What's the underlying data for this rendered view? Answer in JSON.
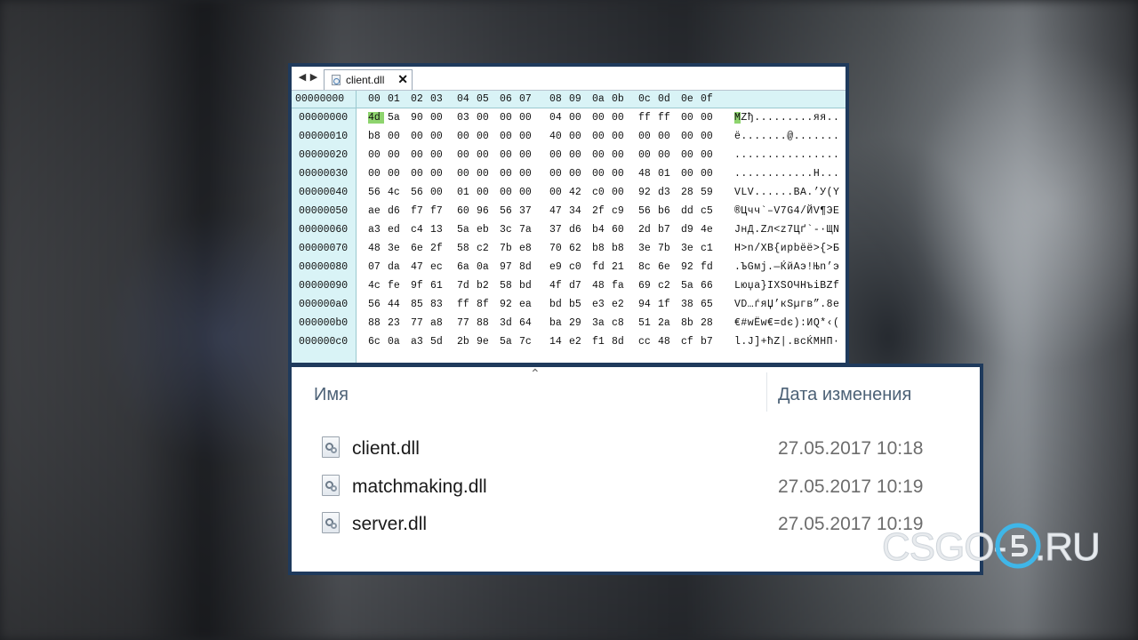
{
  "hex_editor": {
    "tab": {
      "title": "client.dll",
      "close": "✕"
    },
    "nav": {
      "back": "◀",
      "forward": "▶"
    },
    "header": {
      "offset": "00000000",
      "columns": [
        "00",
        "01",
        "02",
        "03",
        "04",
        "05",
        "06",
        "07",
        "08",
        "09",
        "0a",
        "0b",
        "0c",
        "0d",
        "0e",
        "0f"
      ]
    },
    "rows": [
      {
        "offset": "00000000",
        "bytes": [
          "4d",
          "5a",
          "90",
          "00",
          "03",
          "00",
          "00",
          "00",
          "04",
          "00",
          "00",
          "00",
          "ff",
          "ff",
          "00",
          "00"
        ],
        "ascii": "MZђ.........яя.."
      },
      {
        "offset": "00000010",
        "bytes": [
          "b8",
          "00",
          "00",
          "00",
          "00",
          "00",
          "00",
          "00",
          "40",
          "00",
          "00",
          "00",
          "00",
          "00",
          "00",
          "00"
        ],
        "ascii": "ё.......@......."
      },
      {
        "offset": "00000020",
        "bytes": [
          "00",
          "00",
          "00",
          "00",
          "00",
          "00",
          "00",
          "00",
          "00",
          "00",
          "00",
          "00",
          "00",
          "00",
          "00",
          "00"
        ],
        "ascii": "................"
      },
      {
        "offset": "00000030",
        "bytes": [
          "00",
          "00",
          "00",
          "00",
          "00",
          "00",
          "00",
          "00",
          "00",
          "00",
          "00",
          "00",
          "48",
          "01",
          "00",
          "00"
        ],
        "ascii": "............H..."
      },
      {
        "offset": "00000040",
        "bytes": [
          "56",
          "4c",
          "56",
          "00",
          "01",
          "00",
          "00",
          "00",
          "00",
          "42",
          "c0",
          "00",
          "92",
          "d3",
          "28",
          "59"
        ],
        "ascii": "VLV......BA.’У(Y"
      },
      {
        "offset": "00000050",
        "bytes": [
          "ae",
          "d6",
          "f7",
          "f7",
          "60",
          "96",
          "56",
          "37",
          "47",
          "34",
          "2f",
          "c9",
          "56",
          "b6",
          "dd",
          "c5"
        ],
        "ascii": "®Цчч`–V7G4/ЙV¶ЭЕ"
      },
      {
        "offset": "00000060",
        "bytes": [
          "a3",
          "ed",
          "c4",
          "13",
          "5a",
          "eb",
          "3c",
          "7a",
          "37",
          "d6",
          "b4",
          "60",
          "2d",
          "b7",
          "d9",
          "4e"
        ],
        "ascii": "JнД.Zл<z7Цґ`-·ЩN"
      },
      {
        "offset": "00000070",
        "bytes": [
          "48",
          "3e",
          "6e",
          "2f",
          "58",
          "c2",
          "7b",
          "e8",
          "70",
          "62",
          "b8",
          "b8",
          "3e",
          "7b",
          "3e",
          "c1"
        ],
        "ascii": "H>n/XВ{иpbёё>{>Б"
      },
      {
        "offset": "00000080",
        "bytes": [
          "07",
          "da",
          "47",
          "ec",
          "6a",
          "0a",
          "97",
          "8d",
          "e9",
          "c0",
          "fd",
          "21",
          "8c",
          "6e",
          "92",
          "fd"
        ],
        "ascii": ".ЪGмj.—ЌйАэ!Њn’э"
      },
      {
        "offset": "00000090",
        "bytes": [
          "4c",
          "fe",
          "9f",
          "61",
          "7d",
          "b2",
          "58",
          "bd",
          "4f",
          "d7",
          "48",
          "fa",
          "69",
          "c2",
          "5a",
          "66"
        ],
        "ascii": "Lюџa}IXЅOЧHъiВZf"
      },
      {
        "offset": "000000a0",
        "bytes": [
          "56",
          "44",
          "85",
          "83",
          "ff",
          "8f",
          "92",
          "ea",
          "bd",
          "b5",
          "e3",
          "e2",
          "94",
          "1f",
          "38",
          "65"
        ],
        "ascii": "VD…ѓяЏ’кЅµгв”.8e"
      },
      {
        "offset": "000000b0",
        "bytes": [
          "88",
          "23",
          "77",
          "a8",
          "77",
          "88",
          "3d",
          "64",
          "ba",
          "29",
          "3a",
          "c8",
          "51",
          "2a",
          "8b",
          "28"
        ],
        "ascii": "€#wЁw€=dє):ИQ*‹("
      },
      {
        "offset": "000000c0",
        "bytes": [
          "6c",
          "0a",
          "a3",
          "5d",
          "2b",
          "9e",
          "5a",
          "7c",
          "14",
          "e2",
          "f1",
          "8d",
          "cc",
          "48",
          "cf",
          "b7"
        ],
        "ascii": "l.J]+ћZ|.всЌМНП·"
      }
    ]
  },
  "explorer": {
    "columns": {
      "name": "Имя",
      "date": "Дата изменения"
    },
    "files": [
      {
        "name": "client.dll",
        "date": "27.05.2017 10:18"
      },
      {
        "name": "matchmaking.dll",
        "date": "27.05.2017 10:19"
      },
      {
        "name": "server.dll",
        "date": "27.05.2017 10:19"
      }
    ]
  },
  "logo": {
    "left": "CSGO-",
    "right": ".RU"
  }
}
